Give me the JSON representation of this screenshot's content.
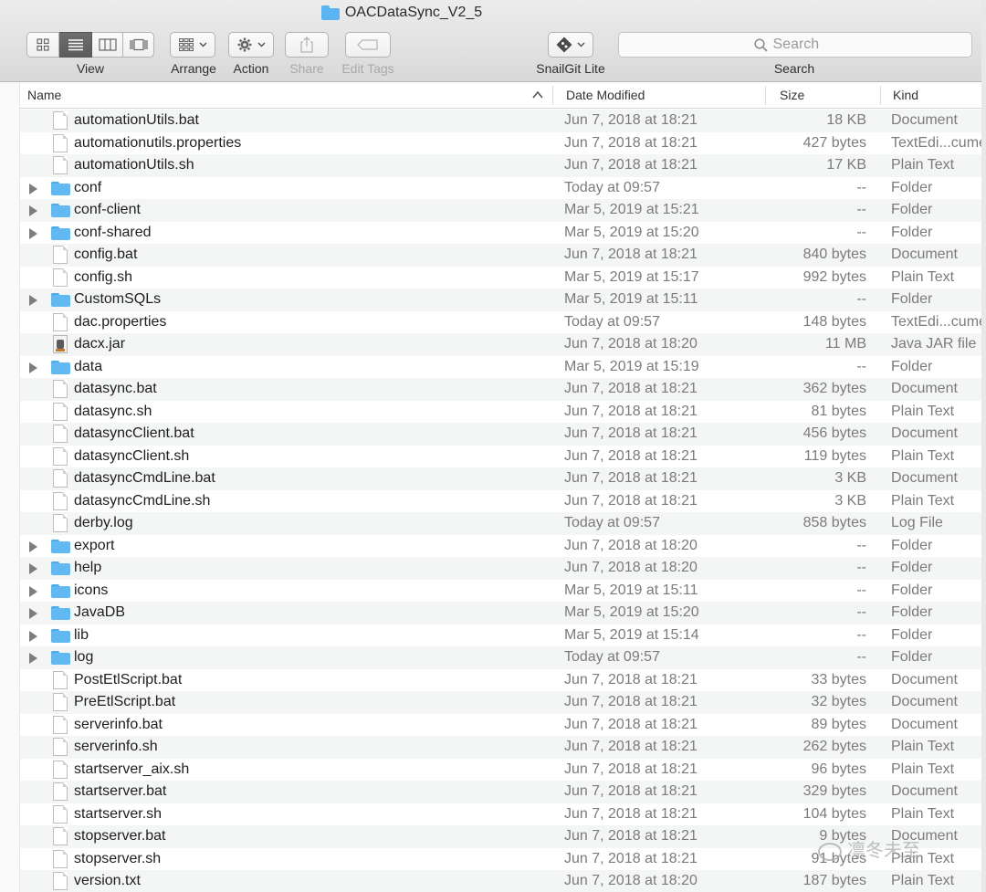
{
  "window": {
    "title": "OACDataSync_V2_5"
  },
  "toolbar": {
    "view_label": "View",
    "arrange_label": "Arrange",
    "action_label": "Action",
    "share_label": "Share",
    "edit_tags_label": "Edit Tags",
    "snailgit_label": "SnailGit Lite",
    "search_label": "Search",
    "search_placeholder": "Search"
  },
  "columns": {
    "name": "Name",
    "date_modified": "Date Modified",
    "size": "Size",
    "kind": "Kind"
  },
  "files": [
    {
      "name": "automationUtils.bat",
      "date": "Jun 7, 2018 at 18:21",
      "size": "18 KB",
      "kind": "Document",
      "type": "doc"
    },
    {
      "name": "automationutils.properties",
      "date": "Jun 7, 2018 at 18:21",
      "size": "427 bytes",
      "kind": "TextEdi...cument",
      "type": "doc"
    },
    {
      "name": "automationUtils.sh",
      "date": "Jun 7, 2018 at 18:21",
      "size": "17 KB",
      "kind": "Plain Text",
      "type": "doc"
    },
    {
      "name": "conf",
      "date": "Today at 09:57",
      "size": "--",
      "kind": "Folder",
      "type": "folder"
    },
    {
      "name": "conf-client",
      "date": "Mar 5, 2019 at 15:21",
      "size": "--",
      "kind": "Folder",
      "type": "folder"
    },
    {
      "name": "conf-shared",
      "date": "Mar 5, 2019 at 15:20",
      "size": "--",
      "kind": "Folder",
      "type": "folder"
    },
    {
      "name": "config.bat",
      "date": "Jun 7, 2018 at 18:21",
      "size": "840 bytes",
      "kind": "Document",
      "type": "doc"
    },
    {
      "name": "config.sh",
      "date": "Mar 5, 2019 at 15:17",
      "size": "992 bytes",
      "kind": "Plain Text",
      "type": "doc"
    },
    {
      "name": "CustomSQLs",
      "date": "Mar 5, 2019 at 15:11",
      "size": "--",
      "kind": "Folder",
      "type": "folder"
    },
    {
      "name": "dac.properties",
      "date": "Today at 09:57",
      "size": "148 bytes",
      "kind": "TextEdi...cument",
      "type": "doc"
    },
    {
      "name": "dacx.jar",
      "date": "Jun 7, 2018 at 18:20",
      "size": "11 MB",
      "kind": "Java JAR file",
      "type": "jar"
    },
    {
      "name": "data",
      "date": "Mar 5, 2019 at 15:19",
      "size": "--",
      "kind": "Folder",
      "type": "folder"
    },
    {
      "name": "datasync.bat",
      "date": "Jun 7, 2018 at 18:21",
      "size": "362 bytes",
      "kind": "Document",
      "type": "doc"
    },
    {
      "name": "datasync.sh",
      "date": "Jun 7, 2018 at 18:21",
      "size": "81 bytes",
      "kind": "Plain Text",
      "type": "doc"
    },
    {
      "name": "datasyncClient.bat",
      "date": "Jun 7, 2018 at 18:21",
      "size": "456 bytes",
      "kind": "Document",
      "type": "doc"
    },
    {
      "name": "datasyncClient.sh",
      "date": "Jun 7, 2018 at 18:21",
      "size": "119 bytes",
      "kind": "Plain Text",
      "type": "doc"
    },
    {
      "name": "datasyncCmdLine.bat",
      "date": "Jun 7, 2018 at 18:21",
      "size": "3 KB",
      "kind": "Document",
      "type": "doc"
    },
    {
      "name": "datasyncCmdLine.sh",
      "date": "Jun 7, 2018 at 18:21",
      "size": "3 KB",
      "kind": "Plain Text",
      "type": "doc"
    },
    {
      "name": "derby.log",
      "date": "Today at 09:57",
      "size": "858 bytes",
      "kind": "Log File",
      "type": "doc"
    },
    {
      "name": "export",
      "date": "Jun 7, 2018 at 18:20",
      "size": "--",
      "kind": "Folder",
      "type": "folder"
    },
    {
      "name": "help",
      "date": "Jun 7, 2018 at 18:20",
      "size": "--",
      "kind": "Folder",
      "type": "folder"
    },
    {
      "name": "icons",
      "date": "Mar 5, 2019 at 15:11",
      "size": "--",
      "kind": "Folder",
      "type": "folder"
    },
    {
      "name": "JavaDB",
      "date": "Mar 5, 2019 at 15:20",
      "size": "--",
      "kind": "Folder",
      "type": "folder"
    },
    {
      "name": "lib",
      "date": "Mar 5, 2019 at 15:14",
      "size": "--",
      "kind": "Folder",
      "type": "folder"
    },
    {
      "name": "log",
      "date": "Today at 09:57",
      "size": "--",
      "kind": "Folder",
      "type": "folder"
    },
    {
      "name": "PostEtlScript.bat",
      "date": "Jun 7, 2018 at 18:21",
      "size": "33 bytes",
      "kind": "Document",
      "type": "doc"
    },
    {
      "name": "PreEtlScript.bat",
      "date": "Jun 7, 2018 at 18:21",
      "size": "32 bytes",
      "kind": "Document",
      "type": "doc"
    },
    {
      "name": "serverinfo.bat",
      "date": "Jun 7, 2018 at 18:21",
      "size": "89 bytes",
      "kind": "Document",
      "type": "doc"
    },
    {
      "name": "serverinfo.sh",
      "date": "Jun 7, 2018 at 18:21",
      "size": "262 bytes",
      "kind": "Plain Text",
      "type": "doc"
    },
    {
      "name": "startserver_aix.sh",
      "date": "Jun 7, 2018 at 18:21",
      "size": "96 bytes",
      "kind": "Plain Text",
      "type": "doc"
    },
    {
      "name": "startserver.bat",
      "date": "Jun 7, 2018 at 18:21",
      "size": "329 bytes",
      "kind": "Document",
      "type": "doc"
    },
    {
      "name": "startserver.sh",
      "date": "Jun 7, 2018 at 18:21",
      "size": "104 bytes",
      "kind": "Plain Text",
      "type": "doc"
    },
    {
      "name": "stopserver.bat",
      "date": "Jun 7, 2018 at 18:21",
      "size": "9 bytes",
      "kind": "Document",
      "type": "doc"
    },
    {
      "name": "stopserver.sh",
      "date": "Jun 7, 2018 at 18:21",
      "size": "91 bytes",
      "kind": "Plain Text",
      "type": "doc"
    },
    {
      "name": "version.txt",
      "date": "Jun 7, 2018 at 18:20",
      "size": "187 bytes",
      "kind": "Plain Text",
      "type": "doc"
    }
  ],
  "watermark": {
    "text": "凛冬未至"
  },
  "colors": {
    "folder_blue": "#62b9f1",
    "row_alt": "#f4f5f5",
    "toolbar_selected": "#5c5c5c"
  }
}
